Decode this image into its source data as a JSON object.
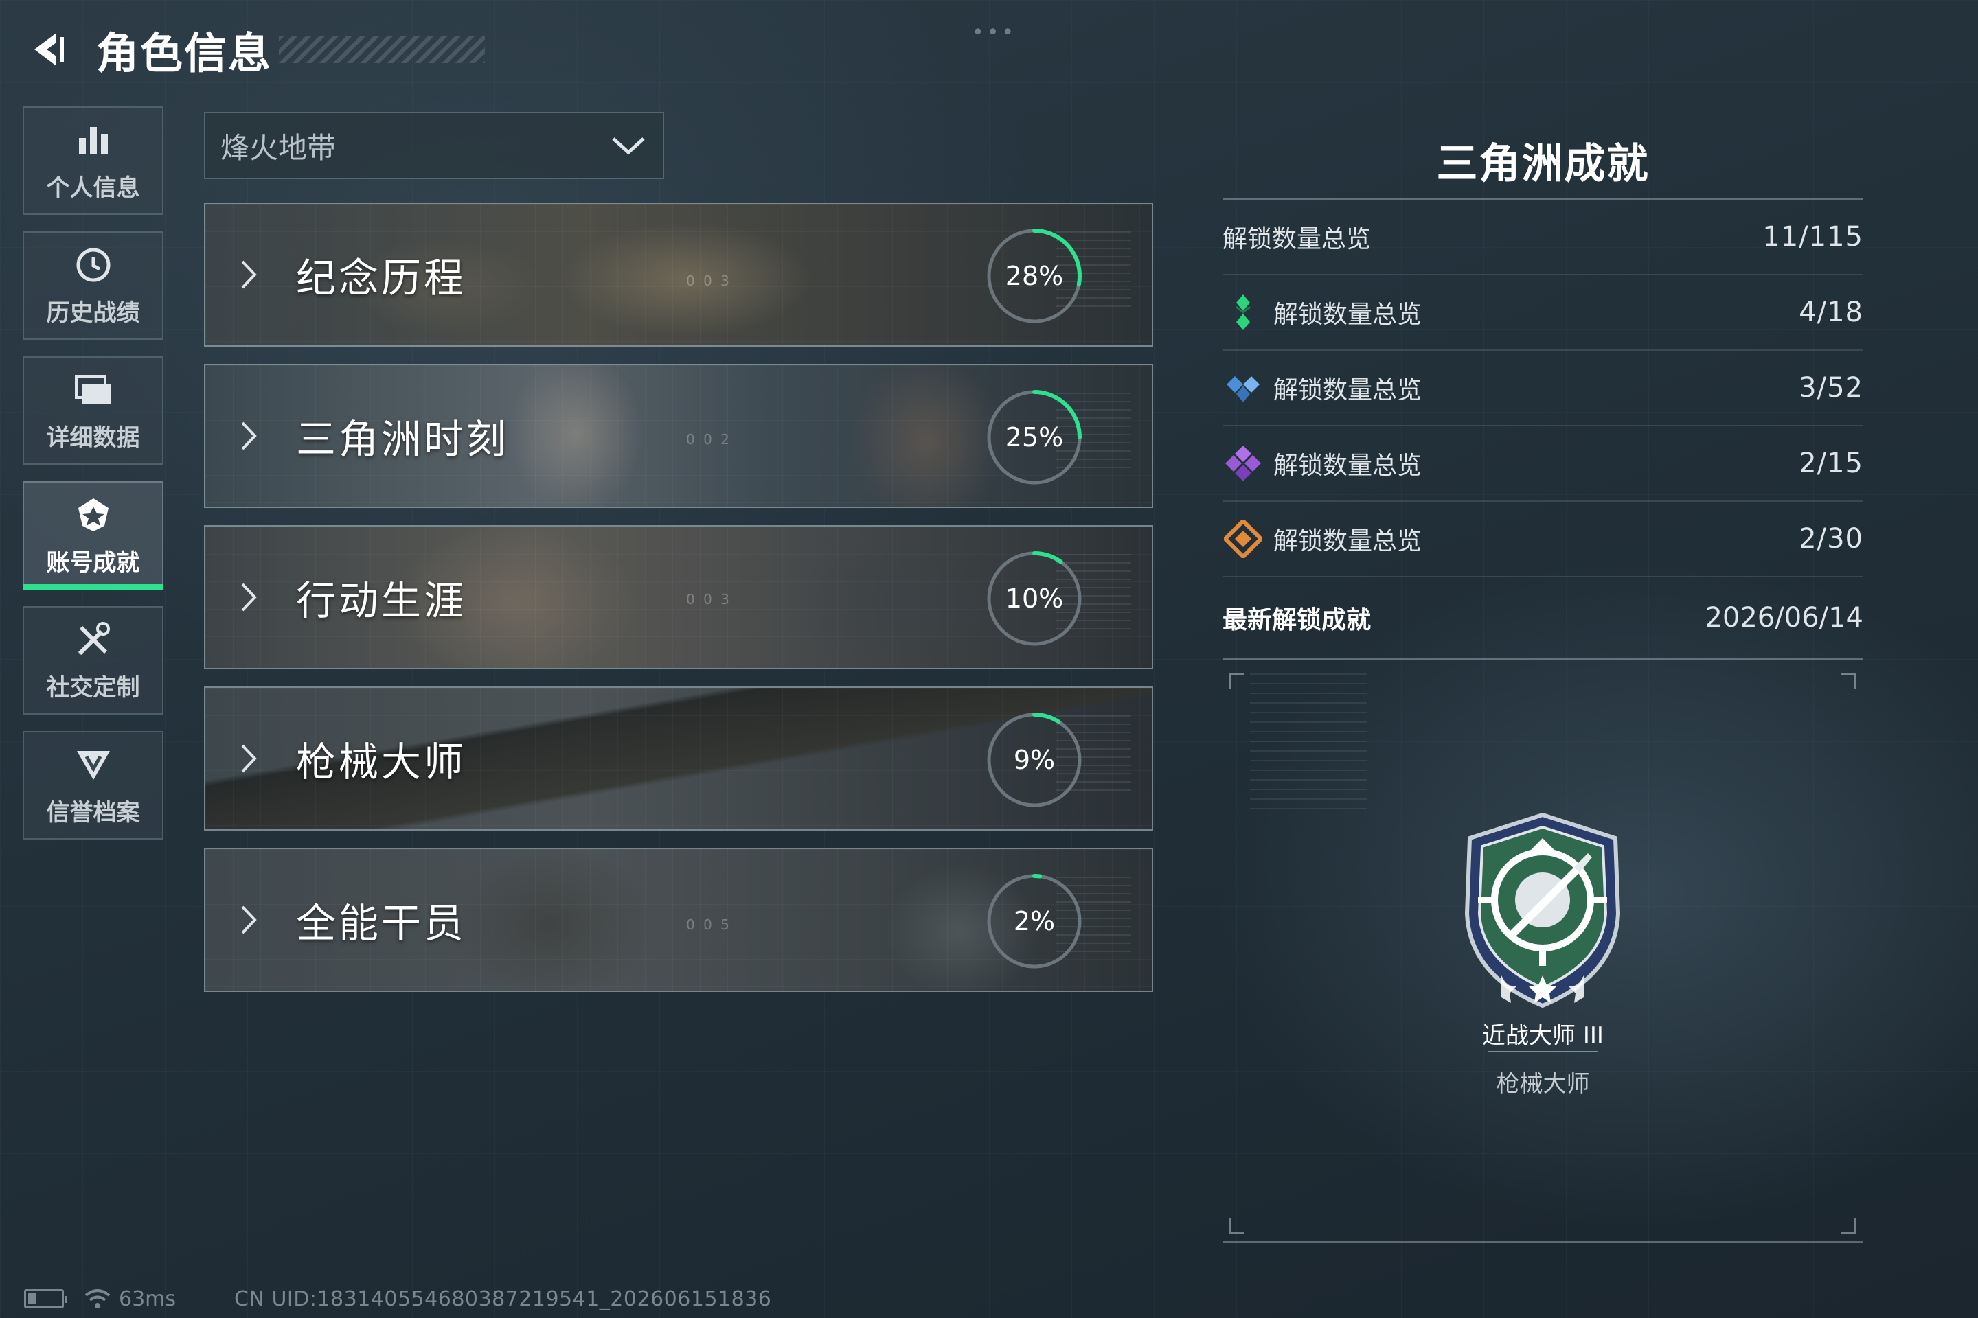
{
  "header": {
    "title": "角色信息"
  },
  "sidebar": {
    "items": [
      {
        "label": "个人信息",
        "icon": "bar-chart-icon"
      },
      {
        "label": "历史战绩",
        "icon": "clock-icon"
      },
      {
        "label": "详细数据",
        "icon": "folder-icon"
      },
      {
        "label": "账号成就",
        "icon": "achievement-icon",
        "active": true
      },
      {
        "label": "社交定制",
        "icon": "tools-icon"
      },
      {
        "label": "信誉档案",
        "icon": "shield-v-icon"
      }
    ]
  },
  "mode_select": {
    "value": "烽火地带"
  },
  "categories": [
    {
      "name": "纪念历程",
      "percent": "28%",
      "progress": 0.28,
      "code": "0 0 3"
    },
    {
      "name": "三角洲时刻",
      "percent": "25%",
      "progress": 0.25,
      "code": "0 0 2"
    },
    {
      "name": "行动生涯",
      "percent": "10%",
      "progress": 0.1,
      "code": "0 0 3"
    },
    {
      "name": "枪械大师",
      "percent": "9%",
      "progress": 0.09,
      "code": ""
    },
    {
      "name": "全能干员",
      "percent": "2%",
      "progress": 0.02,
      "code": "0 0 5"
    }
  ],
  "panel": {
    "title": "三角洲成就",
    "overview": {
      "label": "解锁数量总览",
      "value": "11/115"
    },
    "tiers": [
      {
        "label": "解锁数量总览",
        "value": "4/18",
        "color": "#2ed37e",
        "icon": "green-gem-icon"
      },
      {
        "label": "解锁数量总览",
        "value": "3/52",
        "color": "#4a8fd8",
        "icon": "blue-gem-icon"
      },
      {
        "label": "解锁数量总览",
        "value": "2/15",
        "color": "#9a5ad6",
        "icon": "purple-gem-icon"
      },
      {
        "label": "解锁数量总览",
        "value": "2/30",
        "color": "#e08a3a",
        "icon": "orange-gem-icon"
      }
    ],
    "latest": {
      "label": "最新解锁成就",
      "date": "2026/06/14"
    },
    "featured": {
      "name": "近战大师 III",
      "category": "枪械大师"
    }
  },
  "status_bar": {
    "ping": "63ms",
    "uid": "CN UID:18314055468038721954​1_202606151836"
  },
  "colors": {
    "accent": "#2ee08f",
    "ring_track": "#6a757c"
  }
}
